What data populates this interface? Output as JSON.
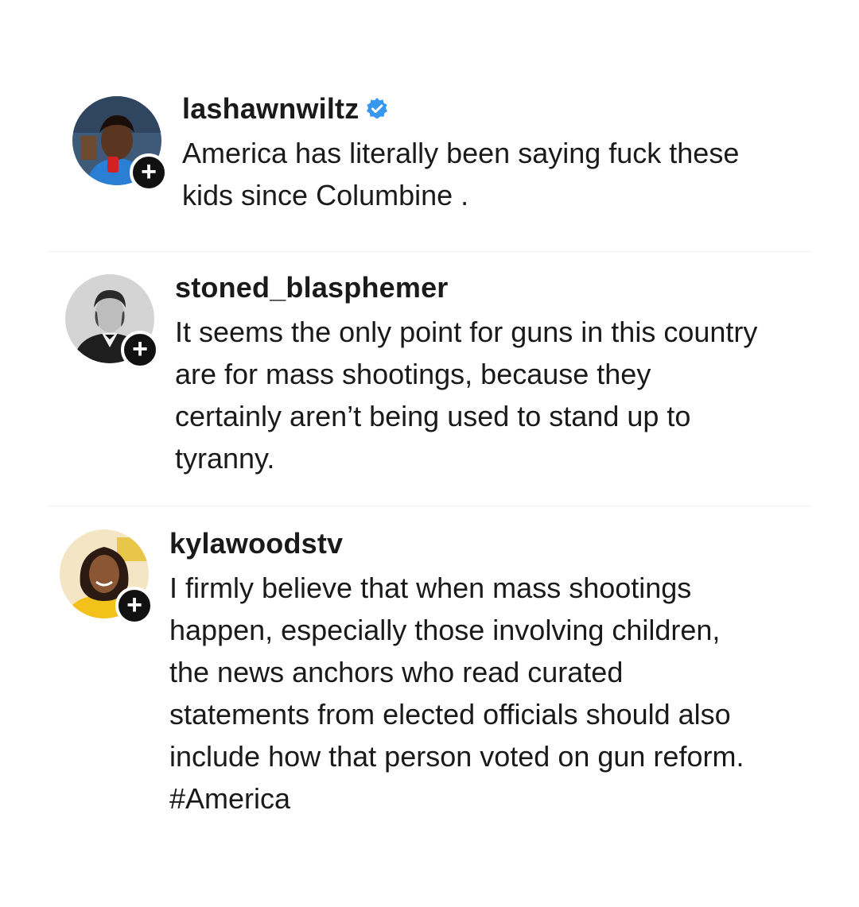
{
  "comments": [
    {
      "username": "lashawnwiltz",
      "verified": true,
      "text": "America has literally been saying fuck these\nkids since Columbine .",
      "follow_icon": "plus-icon",
      "follow_glyph": "+",
      "avatar_colors": {
        "bg": "#3f5a78",
        "skin": "#5a3520",
        "shirt": "#2a7fd4",
        "accent": "#d42020"
      }
    },
    {
      "username": "stoned_blasphemer",
      "verified": false,
      "text": "It seems the only point for guns in this country\nare for mass shootings, because they\ncertainly aren’t being used to stand up to\ntyranny.",
      "follow_icon": "plus-icon",
      "follow_glyph": "+",
      "avatar_colors": {
        "bg": "#cfcfcf",
        "skin": "#bdbdbd",
        "shirt": "#1e1e1e",
        "accent": "#f2f2f2"
      }
    },
    {
      "username": "kylawoodstv",
      "verified": false,
      "text": "I firmly believe that when mass shootings\nhappen, especially those involving children,\nthe news anchors who read curated\nstatements from elected officials should also\ninclude how that person voted on gun reform.\n#America",
      "follow_icon": "plus-icon",
      "follow_glyph": "+",
      "avatar_colors": {
        "bg": "#f4e6c4",
        "skin": "#8a5634",
        "shirt": "#f2c21b",
        "accent": "#2b1a12"
      }
    }
  ],
  "colors": {
    "verified_badge": "#3897f0",
    "text": "#1a1a1a",
    "background": "#ffffff"
  }
}
